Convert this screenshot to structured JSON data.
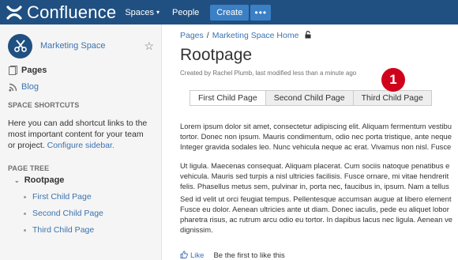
{
  "topbar": {
    "logo_text": "Confluence",
    "spaces_label": "Spaces",
    "people_label": "People",
    "create_label": "Create",
    "more_label": "•••",
    "bg_color": "#205081"
  },
  "sidebar": {
    "space_name": "Marketing Space",
    "pages_label": "Pages",
    "blog_label": "Blog",
    "shortcuts_heading": "SPACE SHORTCUTS",
    "shortcuts_desc_1": "Here you can add shortcut links to the",
    "shortcuts_desc_2": "most important content for your team",
    "shortcuts_desc_3": "or project.",
    "configure_link": "Configure sidebar.",
    "tree_heading": "PAGE TREE",
    "tree_root": "Rootpage",
    "tree_children": [
      "First Child Page",
      "Second Child Page",
      "Third Child Page"
    ]
  },
  "main": {
    "breadcrumb": [
      "Pages",
      "Marketing Space Home"
    ],
    "breadcrumb_sep": "/",
    "title": "Rootpage",
    "byline": "Created by Rachel Plumb, last modified less than a minute ago",
    "tabs": [
      "First Child Page",
      "Second Child Page",
      "Third Child Page"
    ],
    "badge": "1",
    "paragraphs": [
      [
        "Lorem ipsum dolor sit amet, consectetur adipiscing elit. Aliquam fermentum vestibu",
        "tortor. Donec non ipsum. Mauris condimentum, odio nec porta tristique, ante neque",
        "Integer gravida sodales leo. Nunc vehicula neque ac erat. Vivamus non nisl. Fusce"
      ],
      [
        "Ut ligula. Maecenas consequat. Aliquam placerat. Cum sociis natoque penatibus e",
        "vehicula. Mauris sed turpis a nisl ultricies facilisis. Fusce ornare, mi vitae hendrerit",
        "felis. Phasellus metus sem, pulvinar in, porta nec, faucibus in, ipsum. Nam a tellus"
      ],
      [
        "Sed id velit ut orci feugiat tempus. Pellentesque accumsan augue at libero element",
        "Fusce eu dolor. Aenean ultricies ante ut diam. Donec iaculis, pede eu aliquet lobor",
        "pharetra risus, ac rutrum arcu odio eu tortor. In dapibus lacus nec ligula. Aenean ve",
        "dignissim."
      ]
    ],
    "like_label": "Like",
    "like_text": "Be the first to like this"
  },
  "colors": {
    "accent": "#3b73af",
    "badge": "#d0021b",
    "create_button": "#3b7fc4"
  },
  "icons": {
    "logo": "confluence-logo-icon",
    "space_avatar": "scissors-icon",
    "star": "star-icon",
    "pages": "pages-icon",
    "blog": "rss-icon",
    "lock": "unlock-icon",
    "like": "thumbs-up-icon"
  }
}
